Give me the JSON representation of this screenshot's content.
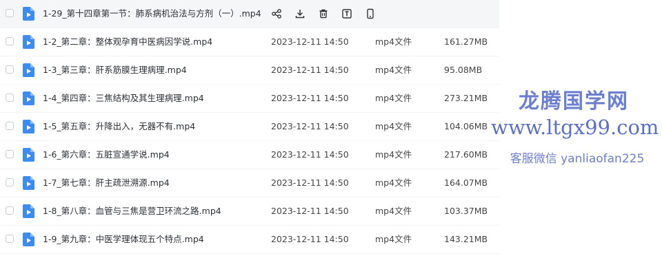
{
  "files": [
    {
      "name": "1-29_第十四章第一节：肺系病机治法与方剂（一）.mp4",
      "date": "",
      "type": "",
      "size": "",
      "hover": true
    },
    {
      "name": "1-2_第二章：整体观孕育中医病因学说.mp4",
      "date": "2023-12-11 14:50",
      "type": "mp4文件",
      "size": "161.27MB"
    },
    {
      "name": "1-3_第三章：肝系筋膜生理病理.mp4",
      "date": "2023-12-11 14:50",
      "type": "mp4文件",
      "size": "95.08MB"
    },
    {
      "name": "1-4_第四章：三焦结构及其生理病理.mp4",
      "date": "2023-12-11 14:50",
      "type": "mp4文件",
      "size": "273.21MB"
    },
    {
      "name": "1-5_第五章：升降出入，无器不有.mp4",
      "date": "2023-12-11 14:50",
      "type": "mp4文件",
      "size": "104.06MB"
    },
    {
      "name": "1-6_第六章：五脏宣通学说.mp4",
      "date": "2023-12-11 14:50",
      "type": "mp4文件",
      "size": "217.60MB"
    },
    {
      "name": "1-7_第七章：肝主疏泄溯源.mp4",
      "date": "2023-12-11 14:50",
      "type": "mp4文件",
      "size": "164.07MB"
    },
    {
      "name": "1-8_第八章：血管与三焦是营卫环流之路.mp4",
      "date": "2023-12-11 14:50",
      "type": "mp4文件",
      "size": "103.37MB"
    },
    {
      "name": "1-9_第九章：中医学理体现五个特点.mp4",
      "date": "2023-12-11 14:50",
      "type": "mp4文件",
      "size": "143.21MB"
    }
  ],
  "row_actions": [
    "share-icon",
    "download-icon",
    "delete-icon",
    "text-icon",
    "mobile-icon"
  ],
  "watermark": {
    "line1": "龙腾国学网",
    "line2": "www.ltgx99.com",
    "line3": "客服微信 yanliaofan225"
  },
  "colors": {
    "file_icon": "#3b8bf0",
    "watermark": "#6b7fd0"
  }
}
